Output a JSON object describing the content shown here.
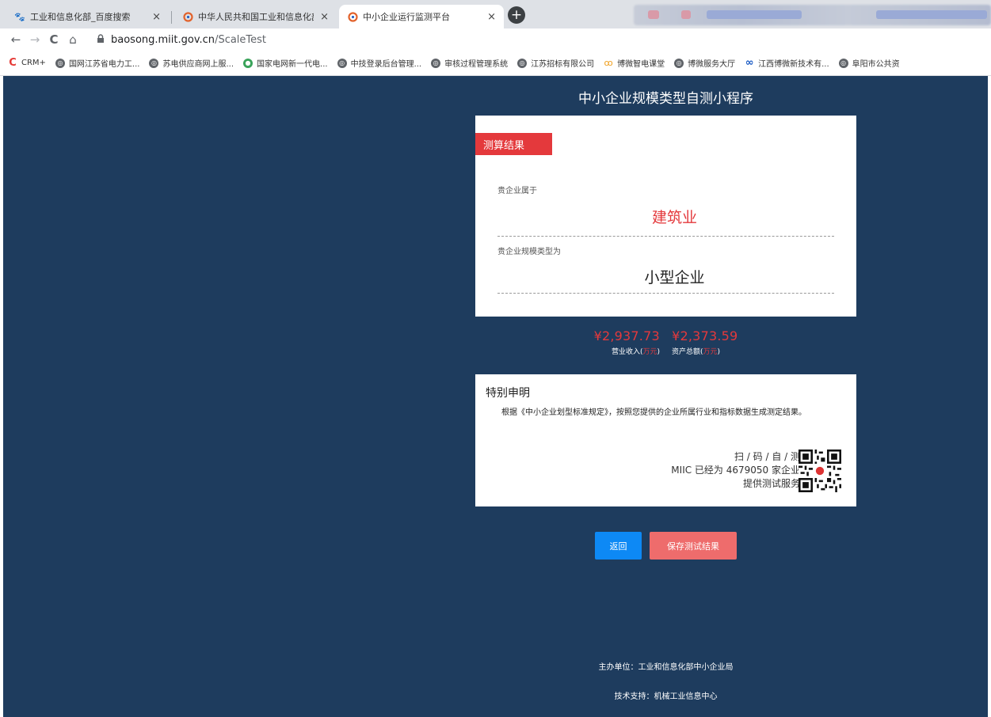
{
  "browser": {
    "tabs": [
      {
        "title": "工业和信息化部_百度搜索",
        "icon": "baidu-paw-icon",
        "close": "×"
      },
      {
        "title": "中华人民共和国工业和信息化部",
        "icon": "miit-logo-icon",
        "close": "×"
      },
      {
        "title": "中小企业运行监测平台",
        "icon": "miit-logo-icon",
        "close": "×"
      }
    ],
    "new_tab": "+",
    "nav": {
      "back": "←",
      "forward": "→",
      "reload": "C",
      "home": "⌂",
      "lock": "🔒"
    },
    "url_host": "baosong.miit.gov.cn",
    "url_path": "/ScaleTest",
    "bookmarks": [
      {
        "label": "CRM+",
        "icon": "crm-icon"
      },
      {
        "label": "国网江苏省电力工...",
        "icon": "globe-icon"
      },
      {
        "label": "苏电供应商网上服...",
        "icon": "globe-icon"
      },
      {
        "label": "国家电网新一代电...",
        "icon": "earth-icon"
      },
      {
        "label": "中技登录后台管理...",
        "icon": "globe-icon"
      },
      {
        "label": "审核过程管理系统",
        "icon": "globe-icon"
      },
      {
        "label": "江苏招标有限公司",
        "icon": "globe-icon"
      },
      {
        "label": "博微智电课堂",
        "icon": "bowei-icon"
      },
      {
        "label": "博微服务大厅",
        "icon": "globe-icon"
      },
      {
        "label": "江西博微新技术有...",
        "icon": "infinity-icon"
      },
      {
        "label": "阜阳市公共资",
        "icon": "globe-icon"
      }
    ]
  },
  "page": {
    "app_title": "中小企业规模类型自测小程序",
    "result_tag": "测算结果",
    "industry_label": "贵企业属于",
    "industry_value": "建筑业",
    "scale_label": "贵企业规模类型为",
    "scale_value": "小型企业",
    "revenue_value": "¥2,937.73",
    "assets_value": "¥2,373.59",
    "revenue_caption": "营业收入",
    "assets_caption": "资产总额",
    "unit": "万元",
    "paren_open": "(",
    "paren_close": ")",
    "declaration_title": "特别申明",
    "declaration_text": "根据《中小企业划型标准规定》，按照您提供的企业所属行业和指标数据生成测定结果。",
    "scan_line1": "扫 / 码 / 自 / 测",
    "scan_line2": "MIIC 已经为 4679050 家企业",
    "scan_line3": "提供测试服务",
    "back_button": "返回",
    "save_button": "保存测试结果",
    "footer_sponsor": "主办单位：工业和信息化部中小企业局",
    "footer_support": "技术支持：机械工业信息中心"
  },
  "colors": {
    "page_bg": "#1e3c5e",
    "accent_red": "#e4393c",
    "back_button": "#0d89f5",
    "save_button": "#ee6c6c"
  }
}
